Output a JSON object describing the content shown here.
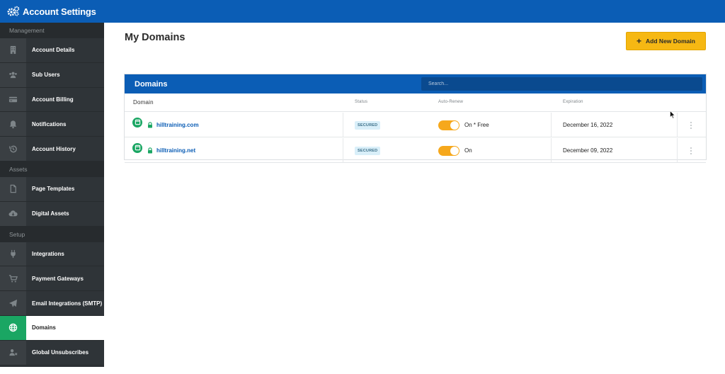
{
  "topbar": {
    "title": "Account Settings",
    "icon": "gears-icon"
  },
  "sidebar": {
    "groups": [
      {
        "label": "Management"
      },
      {
        "label": "Assets"
      },
      {
        "label": "Setup"
      }
    ],
    "items": [
      {
        "label": "Account Details",
        "icon": "building-icon"
      },
      {
        "label": "Sub Users",
        "icon": "users-icon"
      },
      {
        "label": "Account Billing",
        "icon": "credit-card-icon"
      },
      {
        "label": "Notifications",
        "icon": "bell-icon"
      },
      {
        "label": "Account History",
        "icon": "history-icon"
      },
      {
        "label": "Page Templates",
        "icon": "file-icon"
      },
      {
        "label": "Digital Assets",
        "icon": "cloud-download-icon"
      },
      {
        "label": "Integrations",
        "icon": "plug-icon"
      },
      {
        "label": "Payment Gateways",
        "icon": "cart-icon"
      },
      {
        "label": "Email Integrations (SMTP)",
        "icon": "paper-plane-icon"
      },
      {
        "label": "Domains",
        "icon": "globe-icon",
        "active": true
      },
      {
        "label": "Global Unsubscribes",
        "icon": "user-x-icon"
      }
    ]
  },
  "main": {
    "page_title": "My Domains",
    "add_button": "Add New Domain"
  },
  "table": {
    "title": "Domains",
    "search_placeholder": "Search...",
    "columns": {
      "domain": "Domain",
      "status": "Status",
      "auto_renew": "Auto-Renew",
      "expiration": "Expiration"
    },
    "rows": [
      {
        "domain": "hilltraining.com",
        "status": "SECURED",
        "auto_renew": true,
        "auto_renew_text": "On * Free",
        "expiration": "December 16, 2022"
      },
      {
        "domain": "hilltraining.net",
        "status": "SECURED",
        "auto_renew": true,
        "auto_renew_text": "On",
        "expiration": "December 09, 2022"
      }
    ]
  },
  "colors": {
    "brand_blue": "#0b5db5",
    "sidebar_bg": "#2f3438",
    "active_green": "#1aa663",
    "button_yellow": "#f6b813",
    "toggle_orange": "#f6a81c"
  }
}
